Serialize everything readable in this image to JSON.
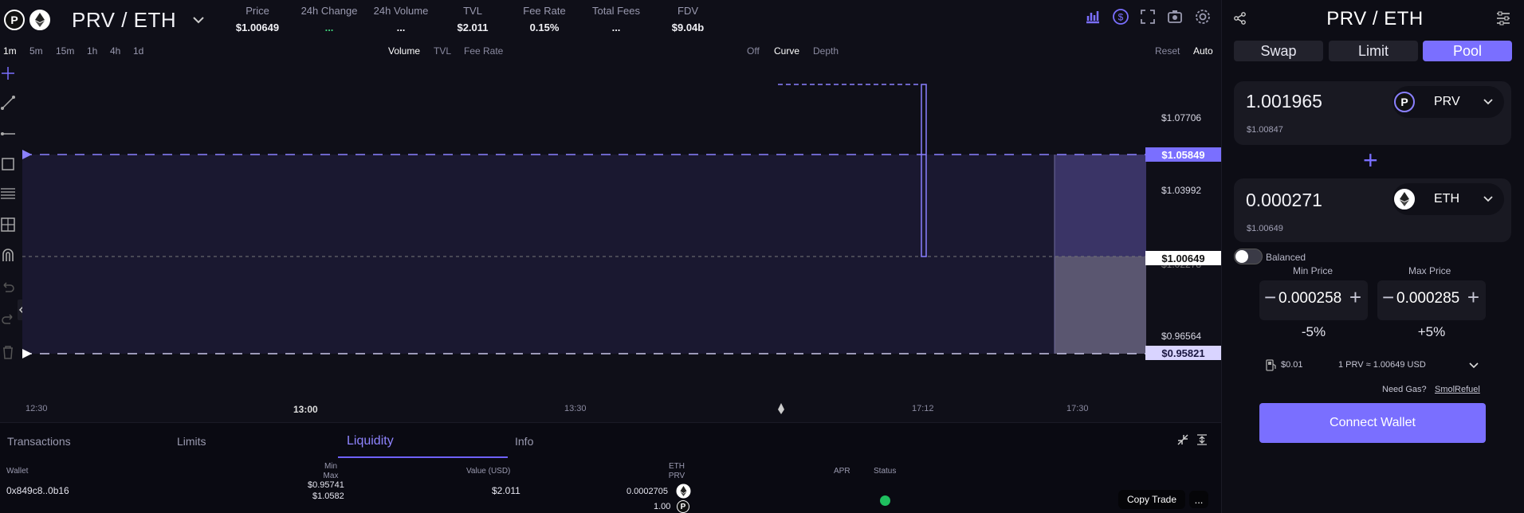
{
  "header": {
    "token_a_letter": "P",
    "pair": "PRV / ETH",
    "stats": [
      {
        "label": "Price",
        "value": "$1.00649"
      },
      {
        "label": "24h Change",
        "value": "..."
      },
      {
        "label": "24h Volume",
        "value": "..."
      },
      {
        "label": "TVL",
        "value": "$2.011"
      },
      {
        "label": "Fee Rate",
        "value": "0.15%"
      },
      {
        "label": "Total Fees",
        "value": "..."
      },
      {
        "label": "FDV",
        "value": "$9.04b"
      }
    ]
  },
  "timeframes": [
    "1m",
    "5m",
    "15m",
    "1h",
    "4h",
    "1d"
  ],
  "metrics": [
    "Volume",
    "TVL",
    "Fee Rate"
  ],
  "views": [
    "Off",
    "Curve",
    "Depth"
  ],
  "chart_controls": {
    "reset": "Reset",
    "auto": "Auto"
  },
  "chart": {
    "price_axis": [
      "$1.07706",
      "$1.03992",
      "$1.02278",
      "$0.96564"
    ],
    "tags": {
      "upper": "$1.05849",
      "current": "$1.00649",
      "lower": "$0.95821"
    },
    "time_axis": [
      "12:30",
      "13:00",
      "13:30",
      "17:12",
      "17:30"
    ],
    "colors": {
      "accent": "#7a6fff",
      "range_fill": "#3a3466"
    }
  },
  "bottom": {
    "tabs": [
      "Transactions",
      "Limits",
      "Liquidity",
      "Info"
    ],
    "columns": {
      "wallet": "Wallet",
      "min": "Min",
      "max": "Max",
      "value": "Value (USD)",
      "eth": "ETH",
      "prv": "PRV",
      "apr": "APR",
      "status": "Status"
    },
    "row": {
      "wallet": "0x849c8..0b16",
      "min": "$0.95741",
      "max": "$1.0582",
      "value": "$2.011",
      "eth_amount": "0.0002705",
      "prv_amount": "1.00",
      "status_color": "#1fbf5f"
    },
    "copy_trade": "Copy Trade",
    "more": "..."
  },
  "panel": {
    "title": "PRV / ETH",
    "tabs": [
      "Swap",
      "Limit",
      "Pool"
    ],
    "token_a": {
      "amount": "1.001965",
      "usd": "$1.00847",
      "symbol": "PRV",
      "letter": "P"
    },
    "token_b": {
      "amount": "0.000271",
      "usd": "$1.00649",
      "symbol": "ETH"
    },
    "balanced": "Balanced",
    "min_price_label": "Min Price",
    "max_price_label": "Max Price",
    "min_price": "0.000258",
    "max_price": "0.000285",
    "min_pct": "-5%",
    "max_pct": "+5%",
    "gas": "$0.01",
    "rate": "1 PRV ≈ 1.00649 USD",
    "need_gas": "Need Gas?",
    "smolrefuel": "SmolRefuel",
    "connect": "Connect Wallet"
  }
}
